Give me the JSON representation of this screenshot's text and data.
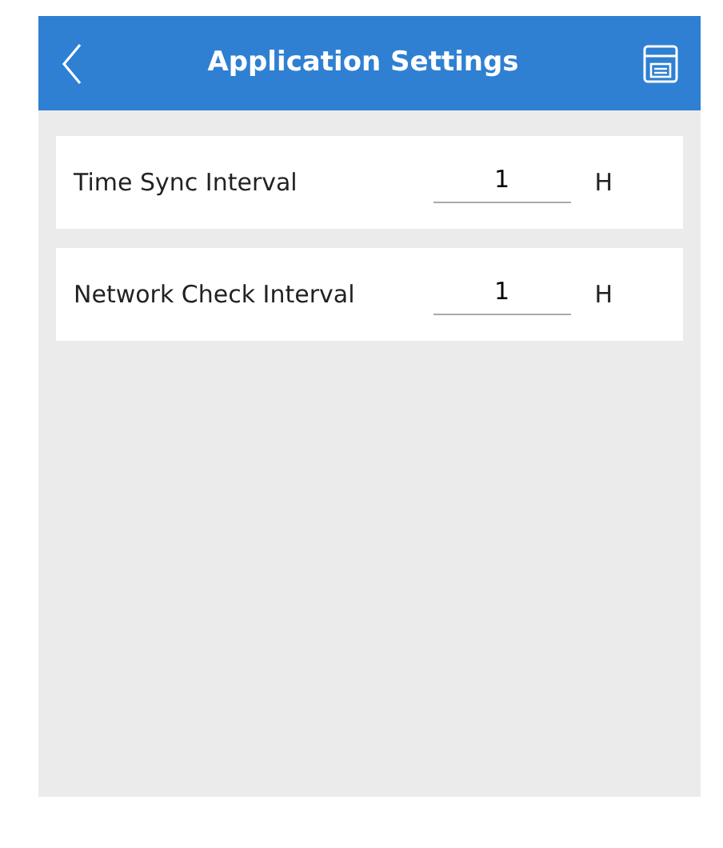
{
  "header": {
    "title": "Application Settings"
  },
  "settings": [
    {
      "label": "Time Sync Interval",
      "value": "1",
      "unit": "H"
    },
    {
      "label": "Network Check Interval",
      "value": "1",
      "unit": "H"
    }
  ]
}
